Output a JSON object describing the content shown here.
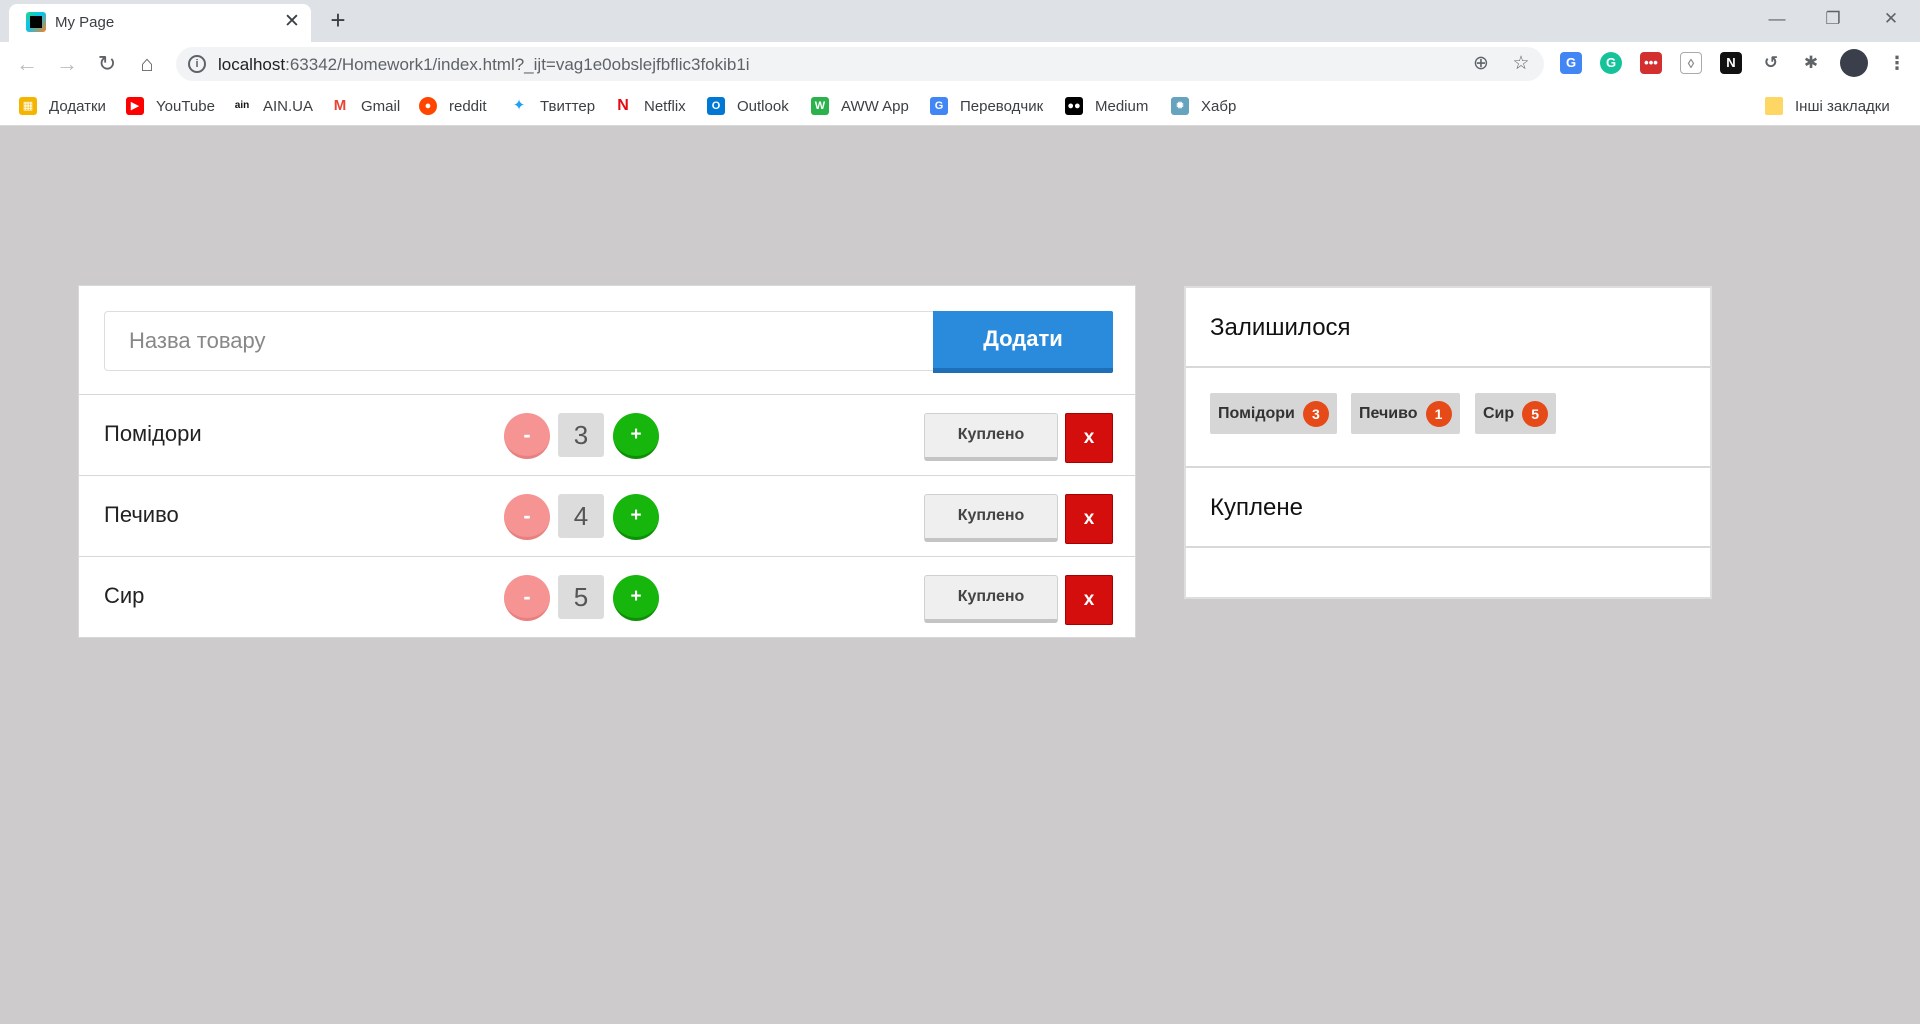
{
  "browser": {
    "tab_title": "My Page",
    "url_host": "localhost",
    "url_rest": ":63342/Homework1/index.html?_ijt=vag1e0obslejfbflic3fokib1i",
    "bookmarks": [
      {
        "label": "Додатки",
        "icon": "apps-grid-icon",
        "color": "#4285f4"
      },
      {
        "label": "YouTube",
        "icon": "youtube-icon",
        "color": "#ff0000"
      },
      {
        "label": "AIN.UA",
        "icon": "ain-icon",
        "color": "#111111"
      },
      {
        "label": "Gmail",
        "icon": "gmail-icon",
        "color": "#ea4335"
      },
      {
        "label": "reddit",
        "icon": "reddit-icon",
        "color": "#ff4500"
      },
      {
        "label": "Твиттер",
        "icon": "twitter-icon",
        "color": "#1da1f2"
      },
      {
        "label": "Netflix",
        "icon": "netflix-icon",
        "color": "#e50914"
      },
      {
        "label": "Outlook",
        "icon": "outlook-icon",
        "color": "#0078d4"
      },
      {
        "label": "AWW App",
        "icon": "aww-icon",
        "color": "#2bb24c"
      },
      {
        "label": "Переводчик",
        "icon": "translate-icon",
        "color": "#4285f4"
      },
      {
        "label": "Medium",
        "icon": "medium-icon",
        "color": "#000000"
      },
      {
        "label": "Хабр",
        "icon": "habr-icon",
        "color": "#65a3be"
      }
    ],
    "other_bookmarks": "Інші закладки"
  },
  "form": {
    "placeholder": "Назва товару",
    "add_label": "Додати"
  },
  "items": [
    {
      "name": "Помідори",
      "qty": "3",
      "minus": "-",
      "plus": "+",
      "bought": "Куплено",
      "delete": "x"
    },
    {
      "name": "Печиво",
      "qty": "4",
      "minus": "-",
      "plus": "+",
      "bought": "Куплено",
      "delete": "x"
    },
    {
      "name": "Сир",
      "qty": "5",
      "minus": "-",
      "plus": "+",
      "bought": "Куплено",
      "delete": "x"
    }
  ],
  "summary": {
    "remaining_title": "Залишилося",
    "remaining": [
      {
        "name": "Помідори",
        "count": "3"
      },
      {
        "name": "Печиво",
        "count": "1"
      },
      {
        "name": "Сир",
        "count": "5"
      }
    ],
    "bought_title": "Куплене"
  },
  "colors": {
    "page_bg": "#cdcbcc",
    "add_button": "#2a8adb",
    "minus_button": "#f59493",
    "plus_button": "#16b60c",
    "delete_button": "#d40d0d",
    "badge": "#e64a19"
  }
}
